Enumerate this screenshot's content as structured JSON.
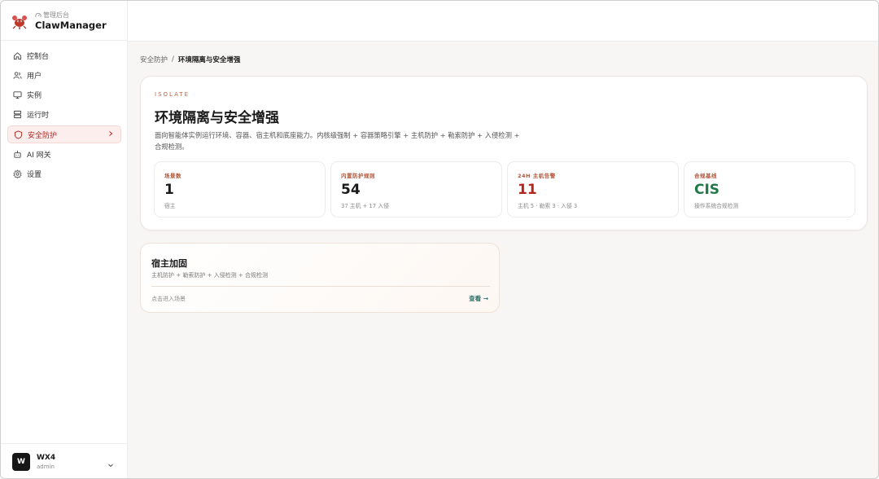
{
  "brand": {
    "subtitle": "管理后台",
    "title": "ClawManager"
  },
  "sidebar": {
    "items": [
      {
        "label": "控制台",
        "icon": "home-icon"
      },
      {
        "label": "用户",
        "icon": "users-icon"
      },
      {
        "label": "实例",
        "icon": "monitor-icon"
      },
      {
        "label": "运行时",
        "icon": "server-icon"
      },
      {
        "label": "安全防护",
        "icon": "shield-icon",
        "active": true
      },
      {
        "label": "AI 网关",
        "icon": "bot-icon"
      },
      {
        "label": "设置",
        "icon": "gear-icon"
      }
    ]
  },
  "user": {
    "initial": "W",
    "name": "WX4",
    "role": "admin"
  },
  "breadcrumb": {
    "parent": "安全防护",
    "separator": "/",
    "current": "环境隔离与安全增强"
  },
  "hero": {
    "eyebrow": "ISOLATE",
    "title": "环境隔离与安全增强",
    "description": "面向智能体实例运行环境、容器、宿主机和底座能力。内核级强制 + 容器策略引擎 + 主机防护 + 勒索防护 + 入侵检测 + 合规检测。"
  },
  "stats": [
    {
      "label": "场景数",
      "value": "1",
      "sub": "宿主",
      "tone": "default"
    },
    {
      "label": "内置防护规则",
      "value": "54",
      "sub": "37 主机 + 17 入侵",
      "tone": "default"
    },
    {
      "label": "24H 主机告警",
      "value": "11",
      "sub": "主机 5 · 勒索 3 · 入侵 3",
      "tone": "red"
    },
    {
      "label": "合规基线",
      "value": "CIS",
      "sub": "操作系统合规检测",
      "tone": "green"
    }
  ],
  "scene": {
    "title": "宿主加固",
    "description": "主机防护 + 勒索防护 + 入侵检测 + 合规检测",
    "hint": "点击进入场景",
    "link": "查看 →"
  }
}
